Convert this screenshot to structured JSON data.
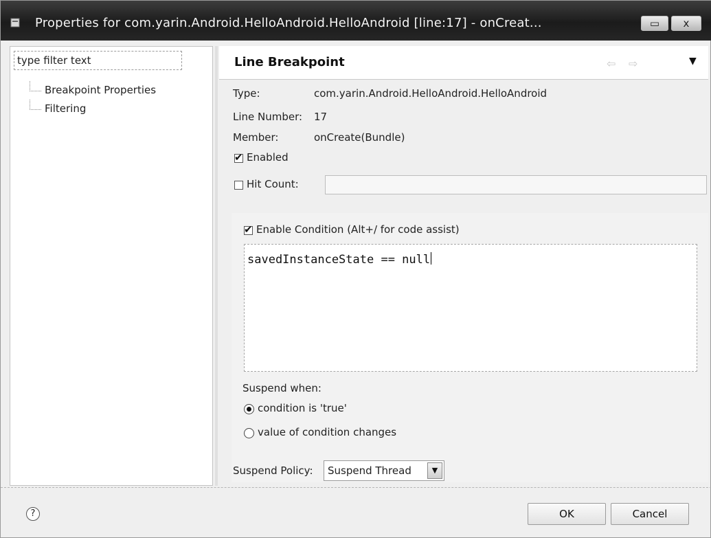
{
  "window": {
    "title": "Properties for com.yarin.Android.HelloAndroid.HelloAndroid [line:17] - onCreat...",
    "maximize_glyph": "▭",
    "close_glyph": "x"
  },
  "left_pane": {
    "filter_placeholder": "type filter text",
    "tree": [
      {
        "label": "Breakpoint Properties"
      },
      {
        "label": "Filtering"
      }
    ]
  },
  "page": {
    "header_title": "Line Breakpoint",
    "nav_back_glyph": "⇦",
    "nav_forward_glyph": "⇨",
    "view_menu_glyph": "▼",
    "type_label": "Type:",
    "type_value": "com.yarin.Android.HelloAndroid.HelloAndroid",
    "line_number_label": "Line Number:",
    "line_number_value": "17",
    "member_label": "Member:",
    "member_value": "onCreate(Bundle)",
    "enabled_label": "Enabled",
    "enabled_checked": true,
    "hit_count_label": "Hit Count:",
    "hit_count_checked": false,
    "hit_count_value": "",
    "enable_condition_label": "Enable Condition (Alt+/ for code assist)",
    "enable_condition_checked": true,
    "condition_code": "savedInstanceState == null",
    "suspend_when_label": "Suspend when:",
    "suspend_options": [
      {
        "label": "condition is 'true'",
        "selected": true
      },
      {
        "label": "value of condition changes",
        "selected": false
      }
    ],
    "suspend_policy_label": "Suspend Policy:",
    "suspend_policy_value": "Suspend Thread"
  },
  "footer": {
    "help_glyph": "?",
    "ok_label": "OK",
    "cancel_label": "Cancel"
  }
}
